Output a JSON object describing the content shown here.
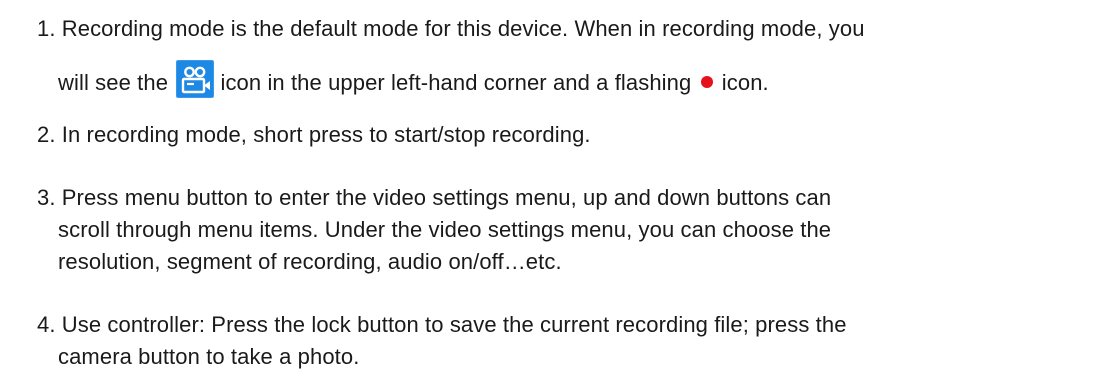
{
  "instructions": {
    "items": [
      {
        "line1": "1. Recording mode is the default mode for this device. When in recording mode, you",
        "line2_before_icon": "will see the",
        "line2_icon": "recording-mode-icon",
        "line2_middle": "icon in the upper left-hand corner and a flashing",
        "line2_dot_icon": "red-dot-icon",
        "line2_after": "icon."
      },
      {
        "line1": "2. In recording mode, short press to start/stop recording."
      },
      {
        "line1": "3. Press menu button to enter the video settings menu, up and down buttons can",
        "line2": "scroll through menu items. Under the video settings menu, you can choose the",
        "line3": "resolution, segment of recording, audio on/off…etc."
      },
      {
        "line1": "4. Use controller: Press the lock button to save the current recording file; press the",
        "line2": "camera button to take a photo."
      }
    ]
  },
  "colors": {
    "text": "#1a1a1a",
    "icon_blue": "#1e88e5",
    "dot_red": "#e5121b"
  }
}
